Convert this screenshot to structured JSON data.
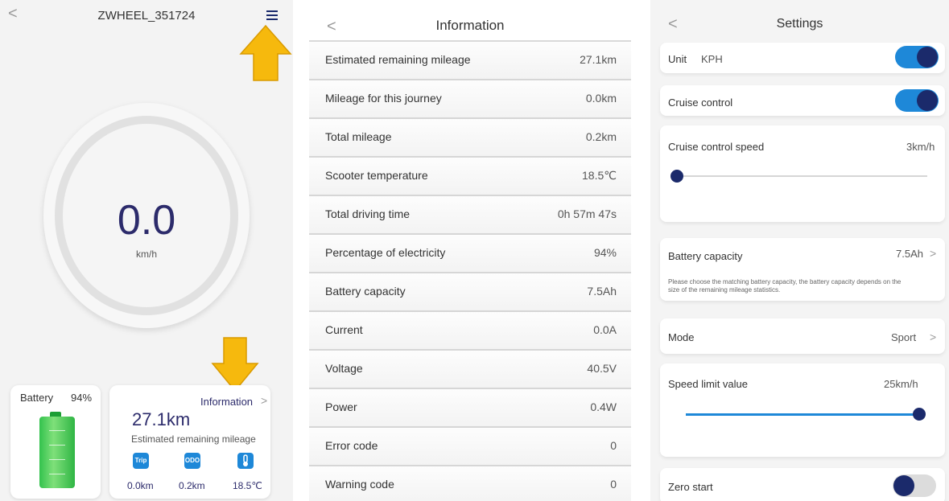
{
  "dashboard": {
    "back_glyph": "<",
    "title": "ZWHEEL_351724",
    "speed": "0.0",
    "speed_unit": "km/h",
    "battery_label": "Battery",
    "battery_percent": "94%",
    "info_link": "Information",
    "info_chevron": ">",
    "remaining_mileage": "27.1km",
    "remaining_label": "Estimated remaining mileage",
    "trip_icon": "Trip",
    "odo_icon": "ODO",
    "trip_value": "0.0km",
    "odo_value": "0.2km",
    "temp_value": "18.5℃",
    "annotation_color": "#f6b90d"
  },
  "information": {
    "back_glyph": "<",
    "title": "Information",
    "rows": [
      {
        "label": "Estimated remaining mileage",
        "value": "27.1km"
      },
      {
        "label": "Mileage for this journey",
        "value": "0.0km"
      },
      {
        "label": "Total mileage",
        "value": "0.2km"
      },
      {
        "label": "Scooter temperature",
        "value": "18.5℃"
      },
      {
        "label": "Total driving time",
        "value": "0h 57m 47s"
      },
      {
        "label": "Percentage of electricity",
        "value": "94%"
      },
      {
        "label": "Battery capacity",
        "value": "7.5Ah"
      },
      {
        "label": "Current",
        "value": "0.0A"
      },
      {
        "label": "Voltage",
        "value": "40.5V"
      },
      {
        "label": "Power",
        "value": "0.4W"
      },
      {
        "label": "Error code",
        "value": "0"
      },
      {
        "label": "Warning code",
        "value": "0"
      }
    ]
  },
  "settings": {
    "back_glyph": "<",
    "title": "Settings",
    "unit_label": "Unit",
    "unit_value": "KPH",
    "unit_toggle": true,
    "cruise_label": "Cruise control",
    "cruise_toggle": true,
    "cruise_speed_label": "Cruise control speed",
    "cruise_speed_value": "3km/h",
    "cruise_speed_fraction": 0.0,
    "battery_capacity_label": "Battery capacity",
    "battery_capacity_value": "7.5Ah",
    "battery_capacity_hint": "Please choose the matching battery capacity, the battery capacity depends on the size of the remaining mileage statistics.",
    "mode_label": "Mode",
    "mode_value": "Sport",
    "chevron": ">",
    "speed_limit_label": "Speed limit value",
    "speed_limit_value": "25km/h",
    "speed_limit_fraction": 1.0,
    "zero_start_label": "Zero start",
    "zero_start_toggle": false
  },
  "colors": {
    "accent_blue": "#1e88d8",
    "navy": "#1b2a6b",
    "battery_green": "#33c24d"
  }
}
